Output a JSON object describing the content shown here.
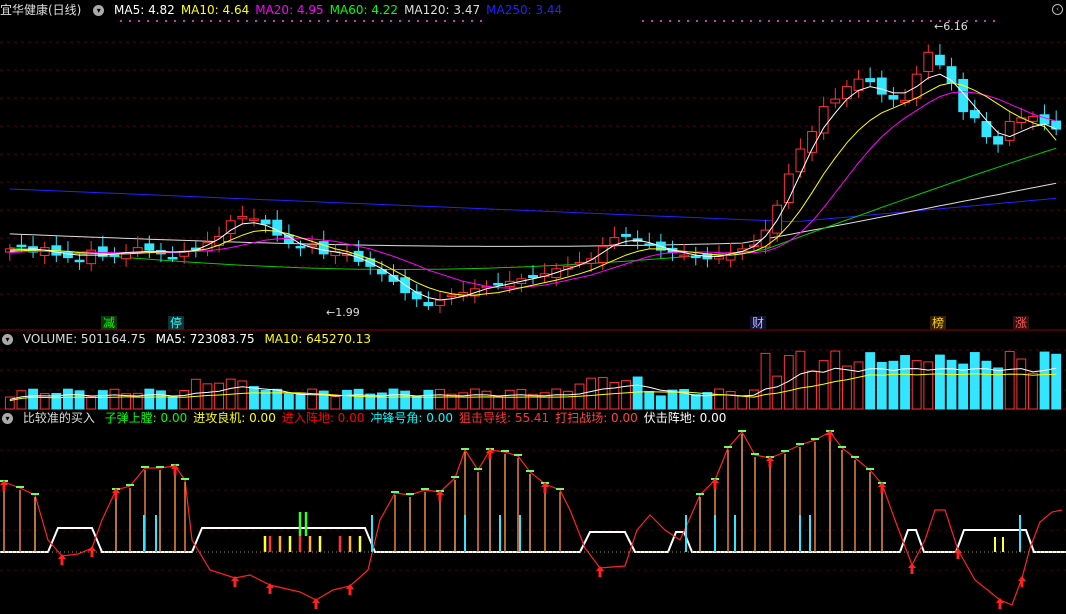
{
  "header": {
    "title": "宜华健康(日线)",
    "ma": [
      {
        "label": "MA5: 4.82",
        "color": "#ffffff"
      },
      {
        "label": "MA10: 4.64",
        "color": "#ffff00"
      },
      {
        "label": "MA20: 4.95",
        "color": "#ff00ff"
      },
      {
        "label": "MA60: 4.22",
        "color": "#00ff00"
      },
      {
        "label": "MA120: 3.47",
        "color": "#dddddd"
      },
      {
        "label": "MA250: 3.44",
        "color": "#2222ff"
      }
    ]
  },
  "volume_header": {
    "title": "VOLUME: 501164.75",
    "ma5": "MA5: 723083.75",
    "ma10": "MA10: 645270.13"
  },
  "indicator_header": {
    "title": "比较准的买入",
    "items": [
      {
        "label": "子弹上膛: 0.00",
        "color": "#00ff00"
      },
      {
        "label": "进攻良机: 0.00",
        "color": "#ffff00"
      },
      {
        "label": "进入阵地: 0.00",
        "color": "#ff0000"
      },
      {
        "label": "冲锋号角: 0.00",
        "color": "#00ffff"
      },
      {
        "label": "狙击导线: 55.41",
        "color": "#ff3333"
      },
      {
        "label": "打扫战场: 0.00",
        "color": "#ff4444"
      },
      {
        "label": "伏击阵地: 0.00",
        "color": "#ffffff"
      }
    ]
  },
  "markers": [
    {
      "text": "减",
      "color": "#00ff00",
      "bg": "#113311"
    },
    {
      "text": "停",
      "color": "#33ffff",
      "bg": "#113333"
    },
    {
      "text": "财",
      "color": "#bbbbff",
      "bg": "#111133"
    },
    {
      "text": "榜",
      "color": "#ffcc00",
      "bg": "#332200"
    },
    {
      "text": "涨",
      "color": "#ff5555",
      "bg": "#331111"
    }
  ],
  "price_labels": {
    "high": "6.16",
    "low": "1.99"
  },
  "icons": {
    "collapse": "chevron-down-icon",
    "scroll": "caret-icon"
  },
  "chart_data": {
    "type": "candlestick",
    "ylim": [
      1.6,
      6.6
    ],
    "candles_close": [
      2.9,
      2.95,
      2.85,
      2.92,
      2.8,
      2.76,
      2.7,
      2.88,
      2.78,
      2.8,
      2.84,
      2.92,
      2.88,
      2.82,
      2.76,
      2.86,
      2.9,
      3.0,
      3.1,
      3.35,
      3.42,
      3.38,
      3.3,
      3.12,
      3.0,
      2.92,
      2.96,
      2.82,
      2.86,
      2.82,
      2.7,
      2.62,
      2.5,
      2.38,
      2.2,
      2.1,
      1.99,
      2.08,
      2.16,
      2.2,
      2.26,
      2.3,
      2.34,
      2.38,
      2.42,
      2.44,
      2.5,
      2.58,
      2.62,
      2.68,
      2.74,
      2.94,
      3.08,
      3.1,
      3.02,
      2.96,
      2.88,
      2.84,
      2.8,
      2.76,
      2.74,
      2.78,
      2.84,
      2.9,
      2.96,
      3.2,
      3.6,
      4.1,
      4.5,
      4.78,
      5.18,
      5.3,
      5.5,
      5.62,
      5.58,
      5.38,
      5.3,
      5.28,
      5.7,
      6.05,
      5.85,
      5.56,
      5.1,
      5.0,
      4.7,
      4.58,
      4.94,
      5.0,
      5.02,
      4.9,
      4.82
    ],
    "ma5": [
      2.88,
      2.89,
      2.9,
      2.88,
      2.85,
      2.82,
      2.8,
      2.8,
      2.8,
      2.82,
      2.84,
      2.85,
      2.86,
      2.86,
      2.85,
      2.85,
      2.88,
      2.96,
      3.06,
      3.2,
      3.3,
      3.32,
      3.28,
      3.2,
      3.1,
      2.98,
      2.92,
      2.88,
      2.85,
      2.82,
      2.76,
      2.68,
      2.58,
      2.46,
      2.32,
      2.2,
      2.12,
      2.08,
      2.1,
      2.14,
      2.2,
      2.26,
      2.3,
      2.34,
      2.38,
      2.42,
      2.46,
      2.52,
      2.58,
      2.64,
      2.72,
      2.84,
      2.96,
      3.02,
      3.04,
      3.0,
      2.94,
      2.88,
      2.84,
      2.8,
      2.78,
      2.78,
      2.82,
      2.86,
      2.94,
      3.1,
      3.36,
      3.7,
      4.1,
      4.5,
      4.84,
      5.08,
      5.3,
      5.44,
      5.5,
      5.46,
      5.4,
      5.4,
      5.5,
      5.64,
      5.7,
      5.6,
      5.4,
      5.18,
      4.96,
      4.76,
      4.7,
      4.78,
      4.86,
      4.9,
      4.82
    ],
    "ma10": [
      2.86,
      2.87,
      2.88,
      2.88,
      2.87,
      2.86,
      2.84,
      2.83,
      2.82,
      2.82,
      2.82,
      2.83,
      2.84,
      2.85,
      2.85,
      2.86,
      2.87,
      2.9,
      2.96,
      3.04,
      3.12,
      3.18,
      3.2,
      3.18,
      3.14,
      3.08,
      3.02,
      2.96,
      2.9,
      2.86,
      2.8,
      2.74,
      2.66,
      2.56,
      2.46,
      2.36,
      2.28,
      2.22,
      2.18,
      2.16,
      2.16,
      2.18,
      2.2,
      2.24,
      2.28,
      2.32,
      2.36,
      2.4,
      2.45,
      2.5,
      2.56,
      2.64,
      2.72,
      2.8,
      2.86,
      2.9,
      2.9,
      2.88,
      2.86,
      2.84,
      2.82,
      2.8,
      2.8,
      2.82,
      2.86,
      2.94,
      3.08,
      3.28,
      3.52,
      3.8,
      4.1,
      4.36,
      4.6,
      4.8,
      4.96,
      5.08,
      5.16,
      5.24,
      5.32,
      5.42,
      5.52,
      5.56,
      5.52,
      5.44,
      5.34,
      5.22,
      5.1,
      5.0,
      4.92,
      4.86,
      4.64
    ],
    "ma20": [
      2.84,
      2.85,
      2.86,
      2.86,
      2.86,
      2.86,
      2.85,
      2.85,
      2.84,
      2.84,
      2.84,
      2.84,
      2.84,
      2.84,
      2.84,
      2.85,
      2.86,
      2.87,
      2.89,
      2.92,
      2.96,
      3.0,
      3.04,
      3.06,
      3.07,
      3.07,
      3.06,
      3.04,
      3.02,
      2.98,
      2.94,
      2.9,
      2.84,
      2.78,
      2.71,
      2.64,
      2.56,
      2.5,
      2.44,
      2.38,
      2.34,
      2.3,
      2.28,
      2.27,
      2.28,
      2.3,
      2.32,
      2.36,
      2.4,
      2.44,
      2.48,
      2.54,
      2.6,
      2.66,
      2.72,
      2.78,
      2.82,
      2.84,
      2.85,
      2.85,
      2.85,
      2.84,
      2.83,
      2.83,
      2.84,
      2.86,
      2.92,
      3.02,
      3.16,
      3.34,
      3.56,
      3.8,
      4.04,
      4.28,
      4.5,
      4.7,
      4.86,
      5.0,
      5.12,
      5.24,
      5.34,
      5.4,
      5.42,
      5.4,
      5.36,
      5.3,
      5.22,
      5.14,
      5.06,
      5.0,
      4.95
    ],
    "ma60_start": 2.92,
    "ma120_start": 3.14,
    "ma250_start": 3.86
  }
}
